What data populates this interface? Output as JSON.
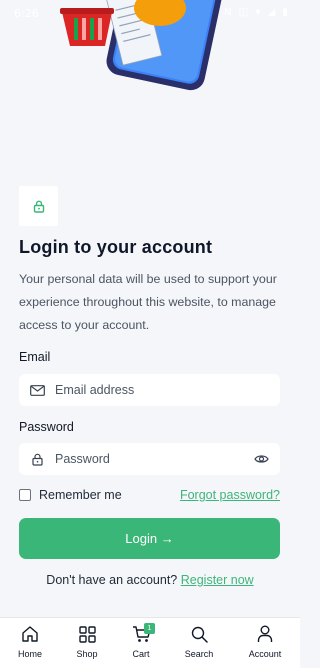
{
  "status_bar": {
    "time": "6:26",
    "icons": "N ◫ ▾ ◢ ▮"
  },
  "login": {
    "title": "Login to your account",
    "intro": "Your personal data will be used to support your experience throughout this website, to manage access to your account.",
    "email_label": "Email",
    "email_placeholder": "Email address",
    "password_label": "Password",
    "password_placeholder": "Password",
    "remember_label": "Remember me",
    "remember_checked": false,
    "forgot_label": "Forgot password?",
    "submit_label": "Login →",
    "register_prompt": "Don't have an account?",
    "register_link": "Register now"
  },
  "bottom_nav": [
    {
      "label": "Home",
      "icon": "home-icon"
    },
    {
      "label": "Shop",
      "icon": "grid-icon"
    },
    {
      "label": "Cart",
      "icon": "cart-icon",
      "badge": "1"
    },
    {
      "label": "Search",
      "icon": "search-icon"
    },
    {
      "label": "Account",
      "icon": "user-icon"
    }
  ],
  "colors": {
    "accent": "#3ab678",
    "background": "#f5f6f9"
  }
}
